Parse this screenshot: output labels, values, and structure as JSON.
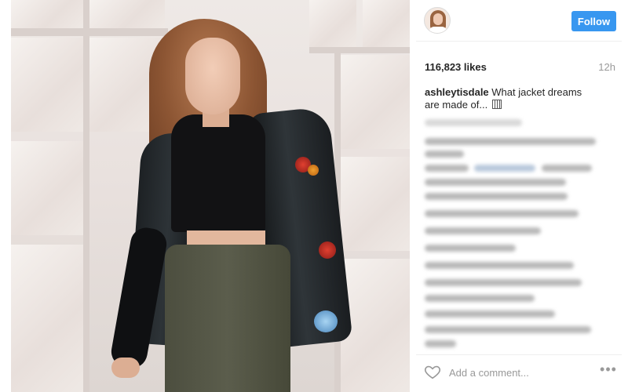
{
  "post": {
    "photo_alt": "Woman in black studded leather jacket with embroidered roses, black crop top and olive joggers, standing in front of white paneled windows",
    "header": {
      "avatar_icon": "profile-avatar",
      "follow_label": "Follow",
      "follow_color": "#3897f0"
    },
    "stats": {
      "likes": "116,823 likes",
      "time_ago": "12h"
    },
    "caption": {
      "username": "ashleytisdale",
      "text": " What jacket dreams are made of... "
    },
    "comments_blurred": true,
    "actions": {
      "like_icon": "heart-icon",
      "comment_placeholder": "Add a comment...",
      "more_icon": "more-options-icon"
    }
  }
}
